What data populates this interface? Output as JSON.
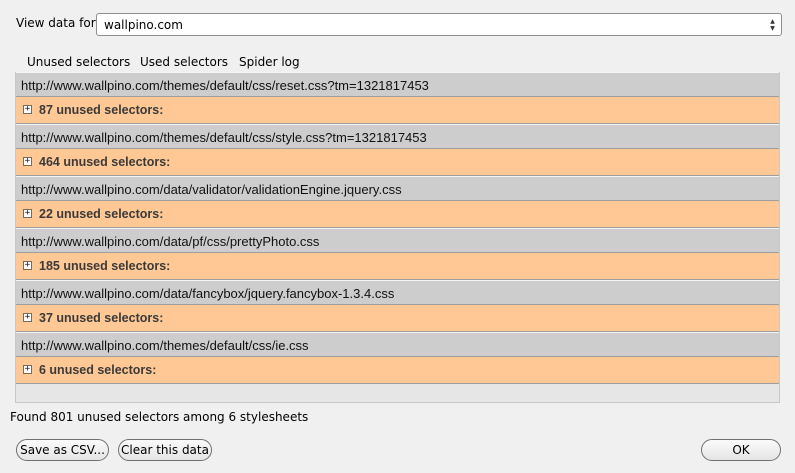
{
  "header": {
    "view_label": "View data for:",
    "site_value": "wallpino.com"
  },
  "tabs": [
    {
      "label": "Unused selectors"
    },
    {
      "label": "Used selectors"
    },
    {
      "label": "Spider log"
    }
  ],
  "stylesheets": [
    {
      "url": "http://www.wallpino.com/themes/default/css/reset.css?tm=1321817453",
      "unused": "87 unused selectors:"
    },
    {
      "url": "http://www.wallpino.com/themes/default/css/style.css?tm=1321817453",
      "unused": "464 unused selectors:"
    },
    {
      "url": "http://www.wallpino.com/data/validator/validationEngine.jquery.css",
      "unused": "22 unused selectors:"
    },
    {
      "url": "http://www.wallpino.com/data/pf/css/prettyPhoto.css",
      "unused": "185 unused selectors:"
    },
    {
      "url": "http://www.wallpino.com/data/fancybox/jquery.fancybox-1.3.4.css",
      "unused": "37 unused selectors:"
    },
    {
      "url": "http://www.wallpino.com/themes/default/css/ie.css",
      "unused": "6 unused selectors:"
    }
  ],
  "expand_symbol": "+",
  "summary": "Found 801 unused selectors among 6 stylesheets",
  "buttons": {
    "save_csv": "Save as CSV...",
    "clear": "Clear this data",
    "ok": "OK"
  },
  "colors": {
    "url_row": "#cdcdcd",
    "selector_row": "#ffc895"
  }
}
